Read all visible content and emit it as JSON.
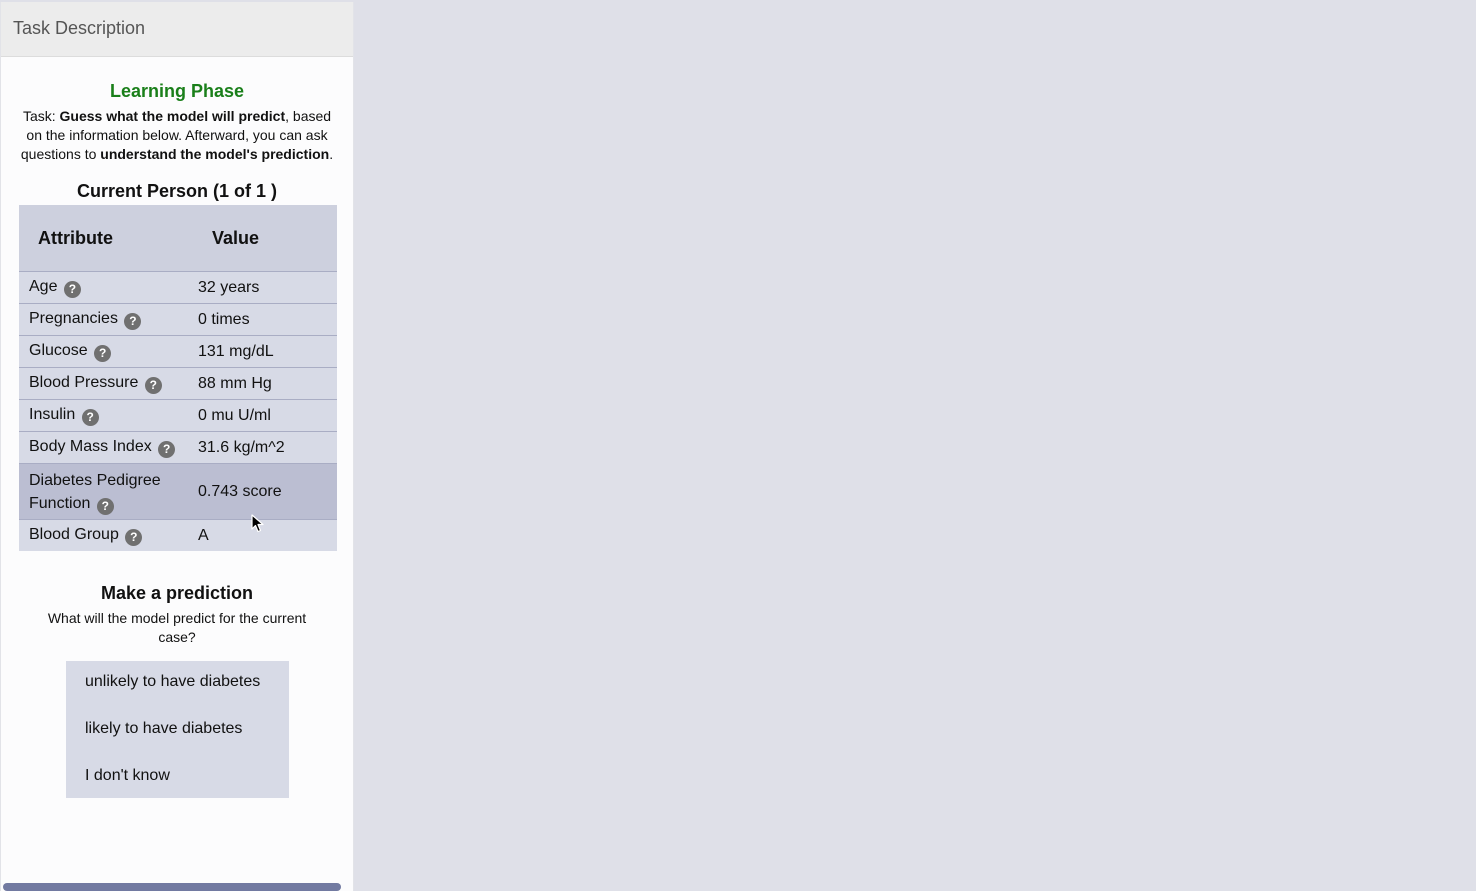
{
  "panel": {
    "header_title": "Task Description"
  },
  "learning": {
    "phase_title": "Learning Phase",
    "task_prefix": "Task: ",
    "task_bold1": "Guess what the model will predict",
    "task_mid": ", based on the information below. Afterward, you can ask questions to ",
    "task_bold2": "understand the model's prediction",
    "task_suffix": "."
  },
  "person": {
    "title": "Current Person (1 of 1 )",
    "col_attribute": "Attribute",
    "col_value": "Value",
    "rows": [
      {
        "attribute": "Age",
        "value": "32 years"
      },
      {
        "attribute": "Pregnancies",
        "value": "0 times"
      },
      {
        "attribute": "Glucose",
        "value": "131 mg/dL"
      },
      {
        "attribute": "Blood Pressure",
        "value": "88 mm Hg"
      },
      {
        "attribute": "Insulin",
        "value": "0 mu U/ml"
      },
      {
        "attribute": "Body Mass Index",
        "value": "31.6 kg/m^2"
      },
      {
        "attribute": "Diabetes Pedigree Function",
        "value": "0.743 score"
      },
      {
        "attribute": "Blood Group",
        "value": "A"
      }
    ],
    "help_glyph": "?"
  },
  "prediction": {
    "title": "Make a prediction",
    "question": "What will the model predict for the current case?",
    "options": [
      "unlikely to have diabetes",
      "likely to have diabetes",
      "I don't know"
    ]
  },
  "colors": {
    "accent_green": "#1a7f1a",
    "table_bg": "#d7dae6",
    "highlight_row": "#bbbed2",
    "scrollbar": "#727aa1"
  }
}
